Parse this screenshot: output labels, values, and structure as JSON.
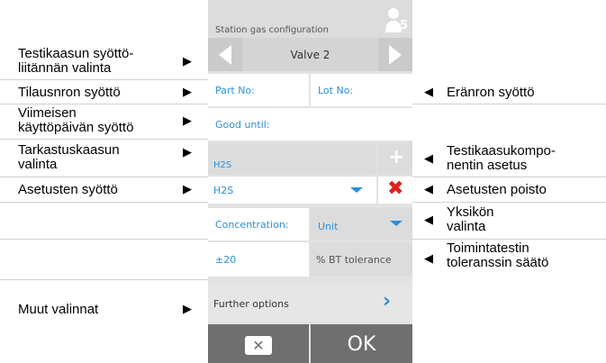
{
  "screen": {
    "title": "Station gas configuration",
    "user_badge": "5",
    "valve_label": "Valve 2",
    "part_no_label": "Part No:",
    "lot_no_label": "Lot No:",
    "good_until_label": "Good until:",
    "check_gas_value": "H2S",
    "settings_value": "H2S",
    "concentration_label": "Concentration:",
    "unit_select": "Unit",
    "tolerance_value": "±20",
    "tolerance_unit": "% BT tolerance",
    "further_options_label": "Further options",
    "ok_label": "OK",
    "cancel_icon": "x-icon",
    "colors": {
      "accent": "#2b8fd8",
      "delete": "#e0201b",
      "button_bg": "#6f6f6f"
    }
  },
  "annotations": {
    "left": {
      "test_gas_port_line1": "Testikaasun syöttö-",
      "test_gas_port_line2": "liitännän valinta",
      "order_no": "Tilausnron syöttö",
      "expiry_line1": "Viimeisen",
      "expiry_line2": "käyttöpäivän syöttö",
      "check_gas_line1": "Tarkastuskaasun",
      "check_gas_line2": "valinta",
      "settings_entry": "Asetusten syöttö",
      "other_options": "Muut valinnat"
    },
    "right": {
      "lot_no": "Eränron syöttö",
      "component_line1": "Testikaasukompo-",
      "component_line2": "nentin asetus",
      "delete_settings": "Asetusten poisto",
      "unit_line1": "Yksikön",
      "unit_line2": "valinta",
      "tolerance_line1": "Toimintatestin",
      "tolerance_line2": "toleranssin säätö"
    }
  }
}
